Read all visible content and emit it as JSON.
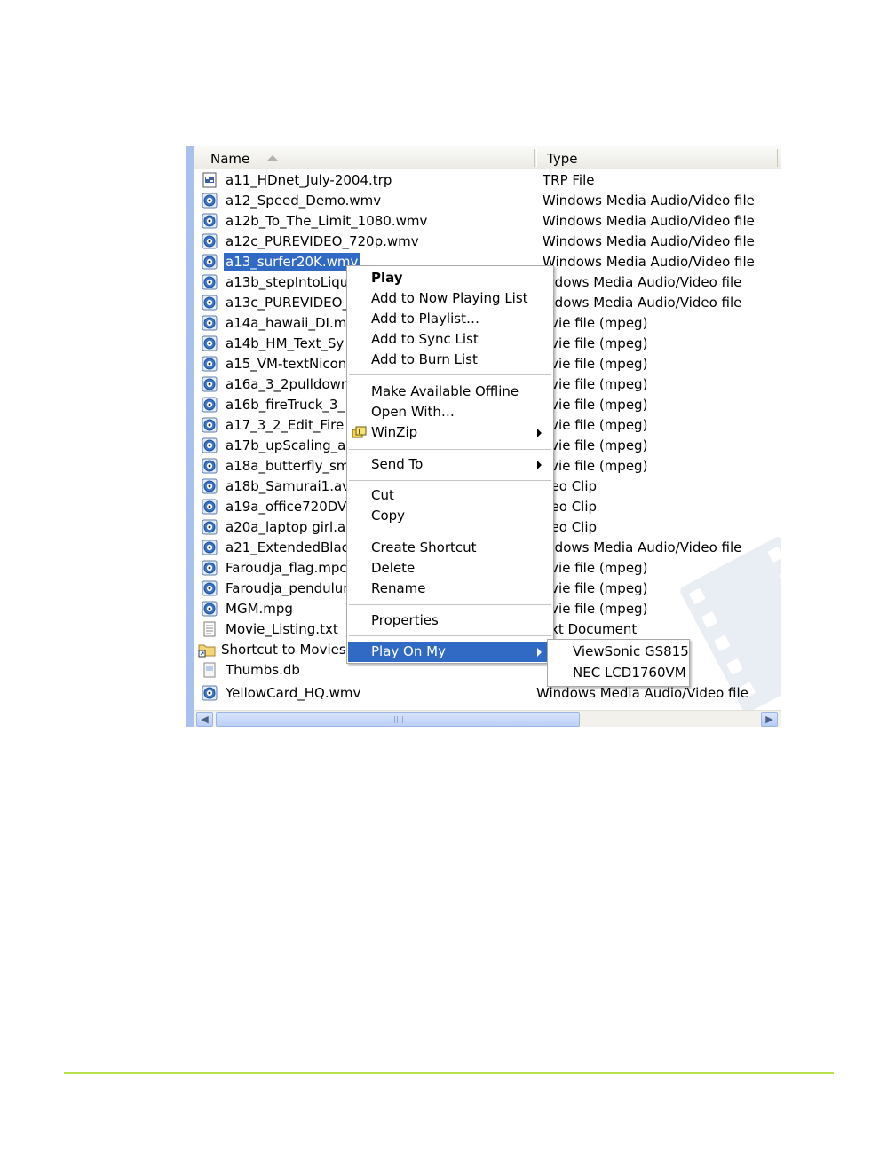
{
  "header": {
    "name_col": "Name",
    "type_col": "Type"
  },
  "files": [
    {
      "name": "a11_HDnet_July-2004.trp",
      "type": "TRP File",
      "icon": "trp-file-icon"
    },
    {
      "name": "a12_Speed_Demo.wmv",
      "type": "Windows Media Audio/Video file",
      "icon": "media-file-icon"
    },
    {
      "name": "a12b_To_The_Limit_1080.wmv",
      "type": "Windows Media Audio/Video file",
      "icon": "media-file-icon"
    },
    {
      "name": "a12c_PUREVIDEO_720p.wmv",
      "type": "Windows Media Audio/Video file",
      "icon": "media-file-icon"
    },
    {
      "name": "a13_surfer20K.wmv",
      "type": "Windows Media Audio/Video file",
      "icon": "media-file-icon",
      "selected": true
    },
    {
      "name": "a13b_stepIntoLiqu",
      "type": "indows Media Audio/Video file",
      "icon": "media-file-icon"
    },
    {
      "name": "a13c_PUREVIDEO_",
      "type": "indows Media Audio/Video file",
      "icon": "media-file-icon"
    },
    {
      "name": "a14a_hawaii_DI.m",
      "type": "ovie file (mpeg)",
      "icon": "media-file-icon"
    },
    {
      "name": "a14b_HM_Text_Sy",
      "type": "ovie file (mpeg)",
      "icon": "media-file-icon"
    },
    {
      "name": "a15_VM-textNicon",
      "type": "ovie file (mpeg)",
      "icon": "media-file-icon"
    },
    {
      "name": "a16a_3_2pulldown",
      "type": "ovie file (mpeg)",
      "icon": "media-file-icon"
    },
    {
      "name": "a16b_fireTruck_3_",
      "type": "ovie file (mpeg)",
      "icon": "media-file-icon"
    },
    {
      "name": "a17_3_2_Edit_Fire",
      "type": "ovie file (mpeg)",
      "icon": "media-file-icon"
    },
    {
      "name": "a17b_upScaling_ar",
      "type": "ovie file (mpeg)",
      "icon": "media-file-icon"
    },
    {
      "name": "a18a_butterfly_sm",
      "type": "ovie file (mpeg)",
      "icon": "media-file-icon"
    },
    {
      "name": "a18b_Samurai1.av",
      "type": "deo Clip",
      "icon": "media-file-icon"
    },
    {
      "name": "a19a_office720DV",
      "type": "deo Clip",
      "icon": "media-file-icon"
    },
    {
      "name": "a20a_laptop girl.a",
      "type": "deo Clip",
      "icon": "media-file-icon"
    },
    {
      "name": "a21_ExtendedBlac",
      "type": "indows Media Audio/Video file",
      "icon": "media-file-icon"
    },
    {
      "name": "Faroudja_flag.mpc",
      "type": "ovie file (mpeg)",
      "icon": "media-file-icon"
    },
    {
      "name": "Faroudja_pendulur",
      "type": "ovie file (mpeg)",
      "icon": "media-file-icon"
    },
    {
      "name": "MGM.mpg",
      "type": "ovie file (mpeg)",
      "icon": "media-file-icon"
    },
    {
      "name": "Movie_Listing.txt",
      "type": "ext Document",
      "icon": "text-file-icon"
    },
    {
      "name": "Shortcut to Movies",
      "type": "",
      "icon": "folder-shortcut-icon"
    },
    {
      "name": "Thumbs.db",
      "type": "",
      "icon": "db-file-icon"
    },
    {
      "name": "YellowCard_HQ.wmv",
      "type": "Windows Media Audio/Video file",
      "icon": "media-file-icon"
    }
  ],
  "context_menu": {
    "play": "Play",
    "add_now_playing": "Add to Now Playing List",
    "add_playlist": "Add to Playlist…",
    "add_sync": "Add to Sync List",
    "add_burn": "Add to Burn List",
    "make_offline": "Make Available Offline",
    "open_with": "Open With…",
    "winzip": "WinZip",
    "send_to": "Send To",
    "cut": "Cut",
    "copy": "Copy",
    "create_shortcut": "Create Shortcut",
    "delete": "Delete",
    "rename": "Rename",
    "properties": "Properties",
    "play_on_my": "Play On My"
  },
  "submenu": {
    "item1": "ViewSonic GS815",
    "item2": "NEC LCD1760VM"
  },
  "colors": {
    "selection": "#316ac5",
    "footer_rule": "#b8e04a"
  }
}
